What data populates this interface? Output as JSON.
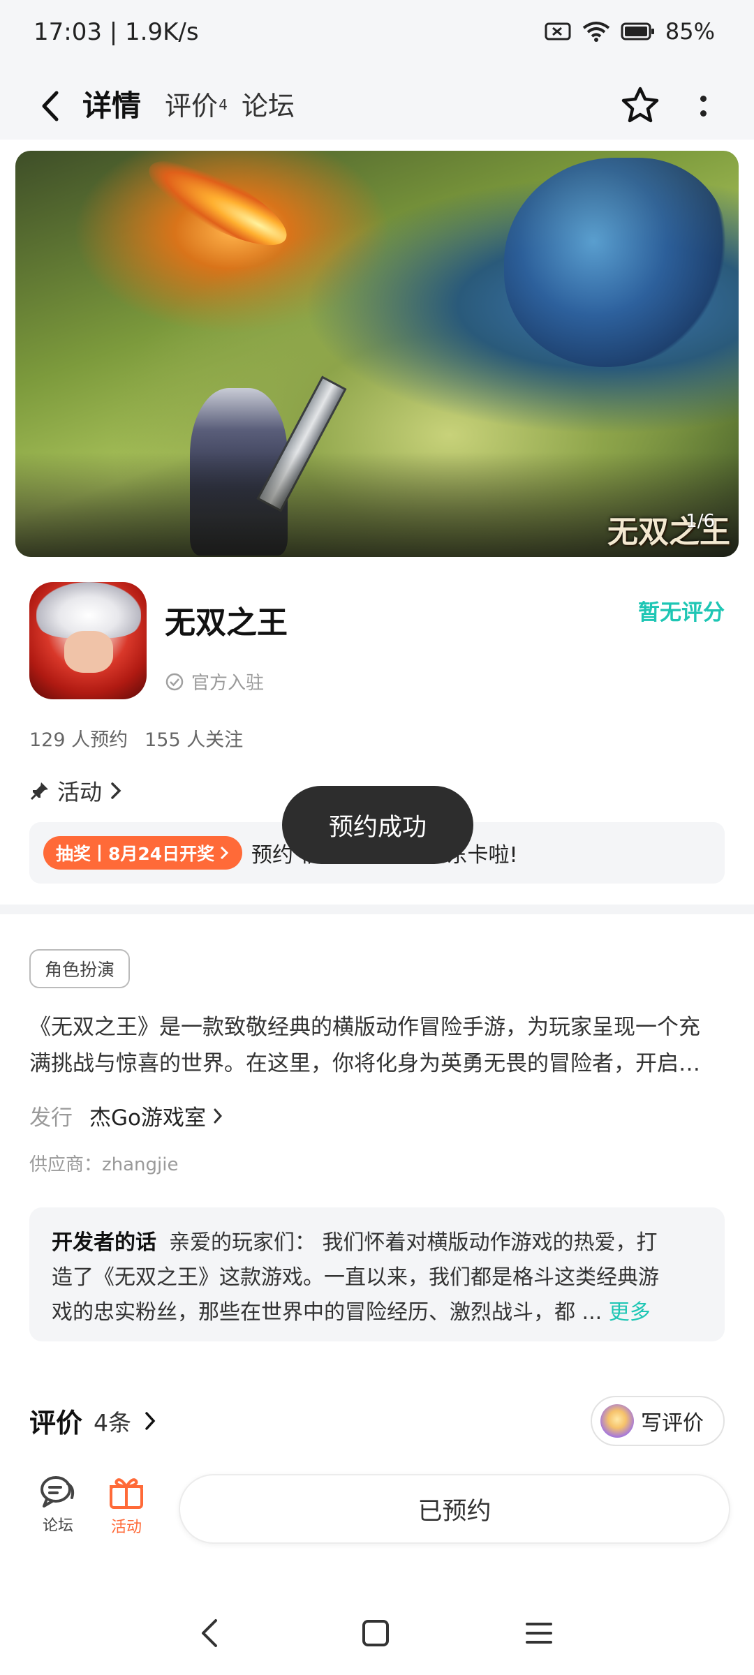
{
  "status_bar": {
    "time_speed": "17:03 | 1.9K/s",
    "battery": "85%",
    "icons": [
      "no-sim-icon",
      "wifi-icon",
      "battery-icon"
    ]
  },
  "nav": {
    "tabs": [
      {
        "label": "详情",
        "active": true
      },
      {
        "label": "评价",
        "badge": "4"
      },
      {
        "label": "论坛"
      }
    ],
    "accent_color": "#1ed3c0"
  },
  "banner": {
    "logo_text": "无双之王",
    "counter": "1/6"
  },
  "app": {
    "name": "无双之王",
    "verified_label": "官方入驻",
    "rating_label": "暂无评分",
    "reservations": "129 人预约",
    "followers": "155 人关注"
  },
  "activity": {
    "header": "活动",
    "tag": "抽奖丨8月24日开奖",
    "text": "预约                       福利】预约送京东卡啦!"
  },
  "toast": "预约成功",
  "genre_tag": "角色扮演",
  "description": {
    "line1": "《无双之王》是一款致敬经典的横版动作冒险手游，为玩家呈现一个充",
    "line2": "满挑战与惊喜的世界。在这里，你将化身为英勇无畏的冒险者，开启…"
  },
  "publisher": {
    "label": "发行",
    "name": "杰Go游戏室"
  },
  "supplier": "供应商：zhangjie",
  "developer_note": {
    "title": "开发者的话",
    "line1": "亲爱的玩家们：  我们怀着对横版动作游戏的热爱，打",
    "line2": "造了《无双之王》这款游戏。一直以来，我们都是格斗这类经典游",
    "line3": "戏的忠实粉丝，那些在世界中的冒险经历、激烈战斗，都 ...",
    "more": "更多"
  },
  "reviews": {
    "title": "评价",
    "count": "4条",
    "write_label": "写评价"
  },
  "bottom_bar": {
    "forum_label": "论坛",
    "activity_label": "活动",
    "reserved_label": "已预约",
    "activity_color": "#ff6a38"
  }
}
